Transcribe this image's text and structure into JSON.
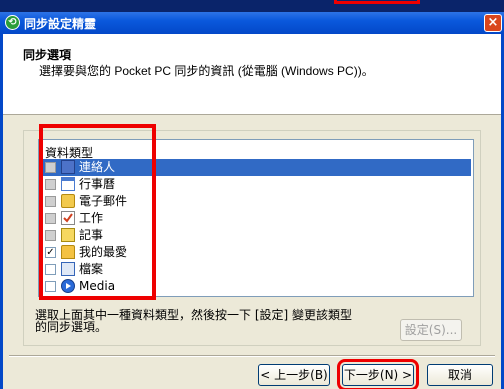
{
  "window": {
    "title": "同步設定精靈",
    "close_label": "×"
  },
  "header": {
    "title": "同步選項",
    "subtitle": "選擇要與您的 Pocket PC 同步的資訊 (從電腦 (Windows PC))。"
  },
  "list": {
    "column_header": "資料類型",
    "items": [
      {
        "label": "連絡人",
        "checked": false,
        "state": "gray",
        "icon": "contacts-icon",
        "selected": true
      },
      {
        "label": "行事曆",
        "checked": false,
        "state": "gray",
        "icon": "calendar-icon"
      },
      {
        "label": "電子郵件",
        "checked": false,
        "state": "gray",
        "icon": "email-icon"
      },
      {
        "label": "工作",
        "checked": false,
        "state": "gray",
        "icon": "tasks-icon"
      },
      {
        "label": "記事",
        "checked": false,
        "state": "gray",
        "icon": "notes-icon"
      },
      {
        "label": "我的最愛",
        "checked": true,
        "state": "checked",
        "icon": "favorites-icon"
      },
      {
        "label": "檔案",
        "checked": false,
        "state": "empty",
        "icon": "files-icon"
      },
      {
        "label": "Media",
        "checked": false,
        "state": "empty",
        "icon": "media-icon"
      }
    ]
  },
  "description": {
    "line1": "選取上面其中一種資料類型，然後按一下 [設定] 變更該類型",
    "line2": "的同步選項。"
  },
  "buttons": {
    "settings": "設定(S)...",
    "back": "< 上一步(B)",
    "next": "下一步(N) >",
    "cancel": "取消"
  },
  "colors": {
    "highlight": "#e00000",
    "selection": "#316ac5",
    "titlebar": "#0348c8"
  }
}
